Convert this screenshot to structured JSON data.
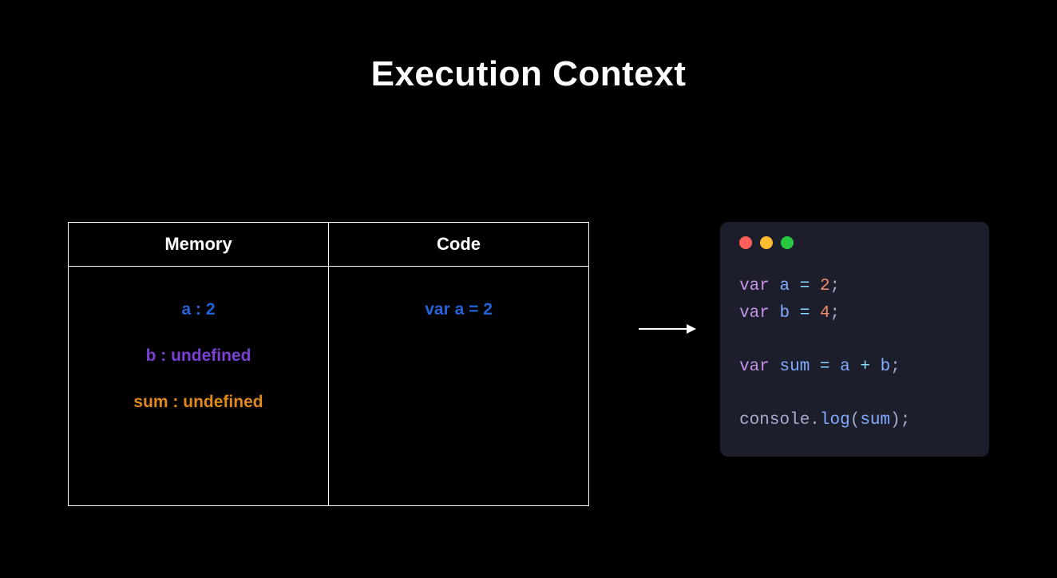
{
  "title": "Execution Context",
  "table": {
    "headers": {
      "memory": "Memory",
      "code": "Code"
    },
    "memory": {
      "a": "a : 2",
      "b": "b : undefined",
      "sum": "sum : undefined"
    },
    "code": {
      "line1": "var a = 2"
    }
  },
  "editor": {
    "l1": {
      "kw": "var",
      "sp1": " ",
      "name": "a",
      "sp2": " ",
      "eq": "=",
      "sp3": " ",
      "val": "2",
      "semi": ";"
    },
    "l2": {
      "kw": "var",
      "sp1": " ",
      "name": "b",
      "sp2": " ",
      "eq": "=",
      "sp3": " ",
      "val": "4",
      "semi": ";"
    },
    "l3": {
      "kw": "var",
      "sp1": " ",
      "name": "sum",
      "sp2": " ",
      "eq": "=",
      "sp3": " ",
      "lhs": "a",
      "sp4": " ",
      "op": "+",
      "sp5": " ",
      "rhs": "b",
      "semi": ";"
    },
    "l4": {
      "obj": "console",
      "dot": ".",
      "fn": "log",
      "lp": "(",
      "arg": "sum",
      "rp": ")",
      "semi": ";"
    }
  }
}
